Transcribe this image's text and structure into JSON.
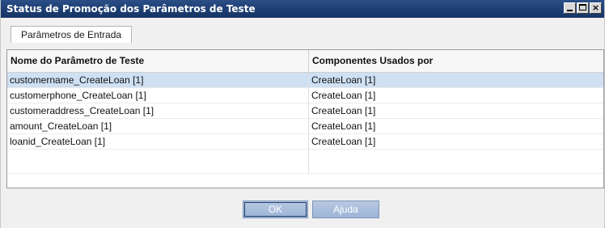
{
  "window": {
    "title": "Status de Promoção dos Parâmetros de Teste",
    "controls": [
      "minimize-icon",
      "maximize-icon",
      "close-icon"
    ],
    "close_glyph": "×"
  },
  "tabs": [
    {
      "label": "Parâmetros de Entrada",
      "active": true
    }
  ],
  "table": {
    "columns": [
      "Nome do Parâmetro de Teste",
      "Componentes Usados por"
    ],
    "rows": [
      {
        "name": "customername_CreateLoan [1]",
        "used_by": "CreateLoan [1]",
        "selected": true
      },
      {
        "name": "customerphone_CreateLoan [1]",
        "used_by": "CreateLoan [1]",
        "selected": false
      },
      {
        "name": "customeraddress_CreateLoan [1]",
        "used_by": "CreateLoan [1]",
        "selected": false
      },
      {
        "name": "amount_CreateLoan [1]",
        "used_by": "CreateLoan [1]",
        "selected": false
      },
      {
        "name": "loanid_CreateLoan [1]",
        "used_by": "CreateLoan [1]",
        "selected": false
      }
    ]
  },
  "buttons": {
    "ok_label": "OK",
    "help_label": "Ajuda"
  },
  "colors": {
    "titlebar": "#1e3f74",
    "selection": "#cfe0f3",
    "button": "#9db5d7"
  }
}
